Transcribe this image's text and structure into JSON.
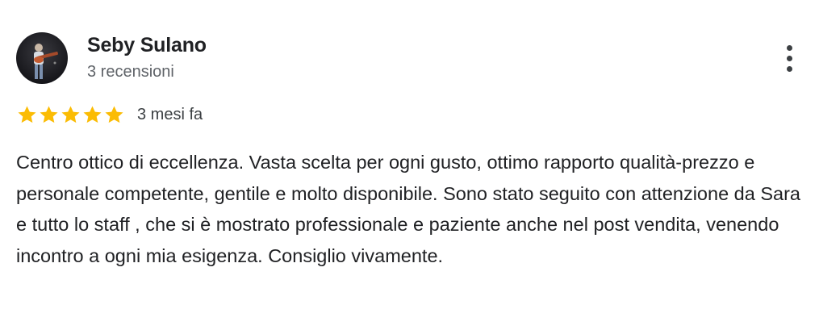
{
  "review": {
    "reviewer": {
      "name": "Seby Sulano",
      "review_count": "3 recensioni",
      "avatar": "reviewer-photo-guitarist"
    },
    "rating": {
      "stars": 5,
      "max_stars": 5,
      "star_color": "#fbbc04"
    },
    "date": "3 mesi fa",
    "text": "Centro ottico di eccellenza. Vasta scelta per ogni gusto, ottimo rapporto qualità-prezzo e personale competente, gentile e molto disponibile. Sono stato seguito con attenzione da Sara e tutto lo staff , che si è mostrato professionale e paziente anche nel post vendita, venendo incontro a ogni mia esigenza. Consiglio vivamente.",
    "menu_icon": "more-vert-icon"
  }
}
